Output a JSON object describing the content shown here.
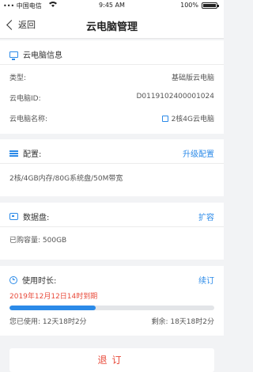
{
  "status_bar": {
    "carrier": "••• 中国电信",
    "wifi_icon": "wifi-icon",
    "time": "9:45 AM",
    "battery_percent_text": "100%",
    "battery_level": 1.0
  },
  "nav": {
    "back_label": "返回",
    "title": "云电脑管理"
  },
  "info_card": {
    "header": "云电脑信息",
    "icon": "monitor-icon",
    "rows": [
      {
        "label": "类型:",
        "value": "基础版云电脑"
      },
      {
        "label": "云电脑ID:",
        "value": "D0119102400001024"
      },
      {
        "label": "云电脑名称:",
        "value": "2核4G云电脑",
        "editable": true
      }
    ]
  },
  "config_card": {
    "header": "配置:",
    "icon": "sliders-icon",
    "action": "升级配置",
    "detail": "2核/4GB内存/80G系统盘/50M带宽"
  },
  "disk_card": {
    "header": "数据盘:",
    "icon": "disk-icon",
    "action": "扩容",
    "detail": "已购容量:  500GB"
  },
  "usage_card": {
    "header": "使用时长:",
    "icon": "clock-icon",
    "action": "续订",
    "expiry": "2019年12月12日14时到期",
    "progress_fraction": 0.42,
    "used_label": "您已使用:",
    "used_value": "12天18时2分",
    "remaining_label": "剩余:",
    "remaining_value": "18天18时2分"
  },
  "bottom_button": {
    "label": "退订"
  },
  "colors": {
    "accent": "#2b8ae8",
    "danger": "#e84a3a",
    "background": "#f2f3f5"
  }
}
